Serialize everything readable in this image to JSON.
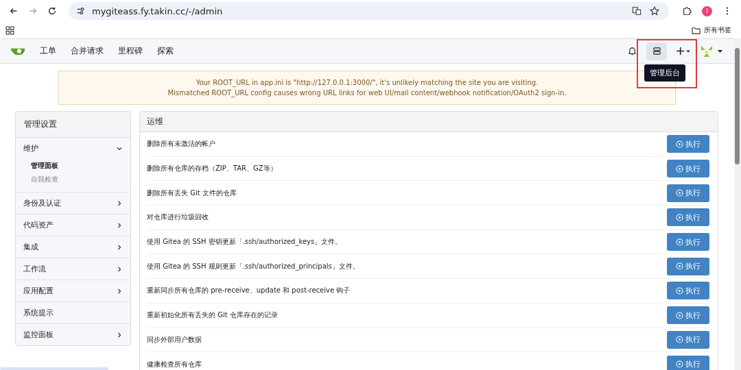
{
  "browser": {
    "url": "mygiteass.fy.takin.cc/-/admin",
    "profile_initial": "I",
    "bookmarks_folder": "所有书签"
  },
  "nav": {
    "items": [
      "工单",
      "合并请求",
      "里程碑",
      "探索"
    ],
    "tooltip": "管理后台"
  },
  "notice": [
    "Your ROOT_URL in app.ini is \"http://127.0.0.1:3000/\", it's unlikely matching the site you are visiting.",
    "Mismatched ROOT_URL config causes wrong URL links for web UI/mail content/webhook notification/OAuth2 sign-in."
  ],
  "sidebar": {
    "title": "管理设置",
    "items": [
      {
        "label": "维护",
        "kind": "group",
        "expanded": true,
        "children": [
          {
            "label": "管理面板",
            "selected": true
          },
          {
            "label": "自我检查",
            "selected": false
          }
        ]
      },
      {
        "label": "身份及认证",
        "kind": "group",
        "expanded": false
      },
      {
        "label": "代码资产",
        "kind": "group",
        "expanded": false
      },
      {
        "label": "集成",
        "kind": "group",
        "expanded": false
      },
      {
        "label": "工作流",
        "kind": "group",
        "expanded": false
      },
      {
        "label": "应用配置",
        "kind": "group",
        "expanded": false
      },
      {
        "label": "系统提示",
        "kind": "link"
      },
      {
        "label": "监控面板",
        "kind": "group",
        "expanded": false
      }
    ]
  },
  "panel": {
    "title": "运维",
    "rows": [
      {
        "label": "删除所有未激活的帐户",
        "button": "执行"
      },
      {
        "label": "删除所有仓库的存档（ZIP、TAR、GZ等）",
        "button": "执行"
      },
      {
        "label": "删除所有丢失 Git 文件的仓库",
        "button": "执行"
      },
      {
        "label": "对仓库进行垃圾回收",
        "button": "执行"
      },
      {
        "label": "使用 Gitea 的 SSH 密钥更新「.ssh/authorized_keys」文件。",
        "button": "执行"
      },
      {
        "label": "使用 Gitea 的 SSH 规则更新「.ssh/authorized_principals」文件。",
        "button": "执行"
      },
      {
        "label": "重新同步所有仓库的 pre-receive、update 和 post-receive 钩子",
        "button": "执行"
      },
      {
        "label": "重新初始化所有丢失的 Git 仓库存在的记录",
        "button": "执行"
      },
      {
        "label": "同步外部用户数据",
        "button": "执行"
      },
      {
        "label": "健康检查所有仓库",
        "button": "执行"
      }
    ]
  }
}
